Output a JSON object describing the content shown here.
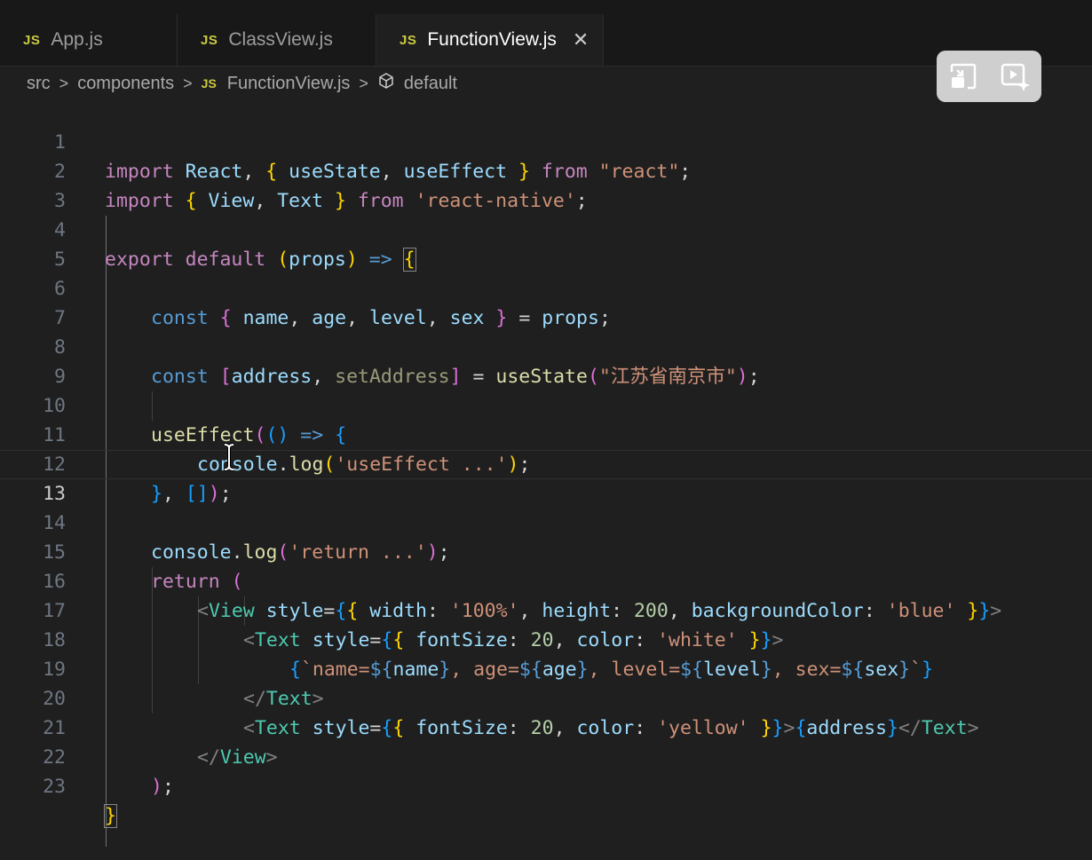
{
  "tabs": [
    {
      "icon": "JS",
      "label": "App.js",
      "active": false
    },
    {
      "icon": "JS",
      "label": "ClassView.js",
      "active": false
    },
    {
      "icon": "JS",
      "label": "FunctionView.js",
      "active": true,
      "close": "✕"
    }
  ],
  "breadcrumb": {
    "folder1": "src",
    "folder2": "components",
    "file_icon": "JS",
    "file": "FunctionView.js",
    "symbol": "default",
    "separator": ">"
  },
  "overlay": {
    "buttons": [
      "exit-picture-in-picture-icon",
      "video-sparkle-icon"
    ]
  },
  "editor": {
    "current_line": 13,
    "line_numbers": [
      "1",
      "2",
      "3",
      "4",
      "5",
      "6",
      "7",
      "8",
      "9",
      "10",
      "11",
      "12",
      "13",
      "14",
      "15",
      "16",
      "17",
      "18",
      "19",
      "20",
      "21",
      "22",
      "23"
    ],
    "tokens": {
      "l1": [
        "import",
        " React",
        ", ",
        "{",
        " useState",
        ", ",
        "useEffect",
        " ",
        "}",
        " from",
        " ",
        "\"react\"",
        ";"
      ],
      "l2": [
        "import",
        " ",
        "{",
        " View",
        ", ",
        "Text",
        " ",
        "}",
        " from",
        " ",
        "'react-native'",
        ";"
      ],
      "l4": [
        "export",
        " ",
        "default",
        " ",
        "(",
        "props",
        ")",
        " => ",
        "{"
      ],
      "l6": [
        "const",
        " ",
        "{",
        " name",
        ", ",
        "age",
        ", ",
        "level",
        ", ",
        "sex",
        " ",
        "}",
        " = ",
        "props",
        ";"
      ],
      "l8": [
        "const",
        " ",
        "[",
        "address",
        ", ",
        "setAddress",
        "]",
        " = ",
        "useState",
        "(",
        "\"江苏省南京市\"",
        ")",
        ";"
      ],
      "l10": [
        "useEffect",
        "(",
        "(",
        ")",
        " => ",
        "{"
      ],
      "l11": [
        "console",
        ".",
        "log",
        "(",
        "'useEffect ...'",
        ")",
        ";"
      ],
      "l12": [
        "}",
        ", ",
        "[",
        "]",
        ")",
        ";"
      ],
      "l14": [
        "console",
        ".",
        "log",
        "(",
        "'return ...'",
        ")",
        ";"
      ],
      "l15": [
        "return",
        " ",
        "("
      ],
      "l16": [
        "<",
        "View",
        " ",
        "style",
        "=",
        "{",
        "{",
        " width",
        ": ",
        "'100%'",
        ", ",
        "height",
        ": ",
        "200",
        ", ",
        "backgroundColor",
        ": ",
        "'blue'",
        " ",
        "}",
        "}",
        ">"
      ],
      "l17": [
        "<",
        "Text",
        " ",
        "style",
        "=",
        "{",
        "{",
        " fontSize",
        ": ",
        "20",
        ", ",
        "color",
        ": ",
        "'white'",
        " ",
        "}",
        "}",
        ">"
      ],
      "l18": [
        "{",
        "`name=",
        "${",
        "name",
        "}",
        ", age=",
        "${",
        "age",
        "}",
        ", level=",
        "${",
        "level",
        "}",
        ", sex=",
        "${",
        "sex",
        "}",
        "`",
        "}"
      ],
      "l19": [
        "</",
        "Text",
        ">"
      ],
      "l20": [
        "<",
        "Text",
        " ",
        "style",
        "=",
        "{",
        "{",
        " fontSize",
        ": ",
        "20",
        ", ",
        "color",
        ": ",
        "'yellow'",
        " ",
        "}",
        "}",
        ">",
        "{",
        "address",
        "}",
        "</",
        "Text",
        ">"
      ],
      "l21": [
        "</",
        "View",
        ">"
      ],
      "l22": [
        ")",
        ";"
      ],
      "l23": [
        "}"
      ]
    }
  },
  "colors": {
    "background": "#1f1f1f",
    "keyword": "#c586c0",
    "storage": "#569cd6",
    "variable": "#9cdcfe",
    "function": "#dcdcaa",
    "string": "#ce9178",
    "number": "#b5cea8",
    "bracket_gold": "#ffd700",
    "bracket_orchid": "#da70d6",
    "bracket_blue": "#179fff",
    "tag": "#4ec9b0",
    "js_icon": "#cbcb41"
  }
}
